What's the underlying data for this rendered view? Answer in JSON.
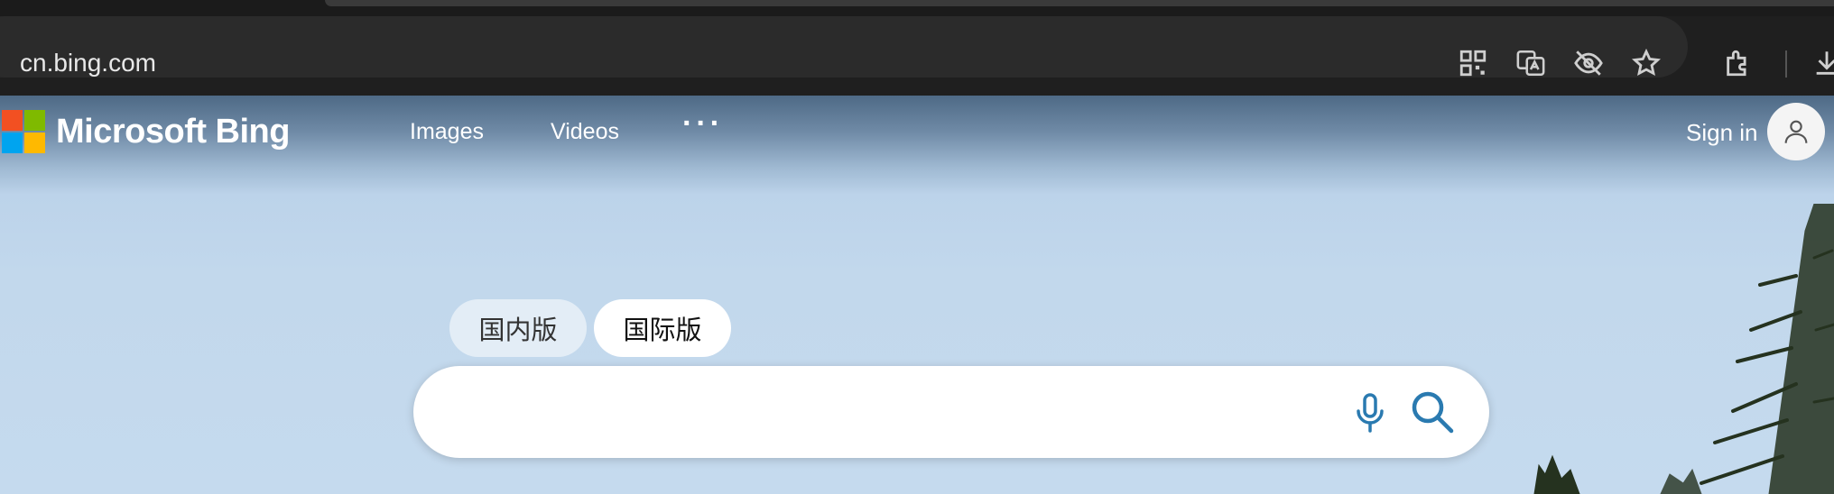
{
  "browser": {
    "url": "cn.bing.com",
    "toolbar_icons": [
      "qr-code-icon",
      "translate-icon",
      "eye-off-icon",
      "star-icon",
      "extensions-icon",
      "download-icon"
    ]
  },
  "header": {
    "logo_text": "Microsoft Bing",
    "nav": [
      {
        "label": "Images"
      },
      {
        "label": "Videos"
      }
    ],
    "more_label": "···",
    "sign_in_label": "Sign in"
  },
  "search": {
    "region_tabs": [
      {
        "label": "国内版",
        "selected": false
      },
      {
        "label": "国际版",
        "selected": true
      }
    ],
    "query": "",
    "accent_color": "#2a7ab0"
  }
}
